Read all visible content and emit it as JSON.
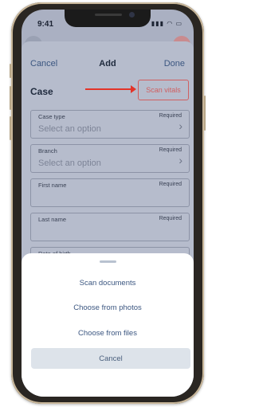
{
  "status_bar": {
    "time": "9:41"
  },
  "header": {
    "cancel_label": "Cancel",
    "title": "Add",
    "done_label": "Done"
  },
  "form": {
    "section_title": "Case",
    "scan_vitals_label": "Scan vitals",
    "fields": [
      {
        "label": "Case type",
        "required": "Required",
        "value": "Select an option"
      },
      {
        "label": "Branch",
        "required": "Required",
        "value": "Select an option"
      },
      {
        "label": "First name",
        "required": "Required",
        "value": ""
      },
      {
        "label": "Last name",
        "required": "Required",
        "value": ""
      },
      {
        "label": "Date of birth",
        "required": "",
        "value": ""
      }
    ]
  },
  "action_sheet": {
    "options": [
      "Scan documents",
      "Choose from photos",
      "Choose from files"
    ],
    "cancel_label": "Cancel"
  },
  "colors": {
    "accent": "#3b5680",
    "highlight_border": "#d05f60",
    "arrow": "#e33429"
  }
}
